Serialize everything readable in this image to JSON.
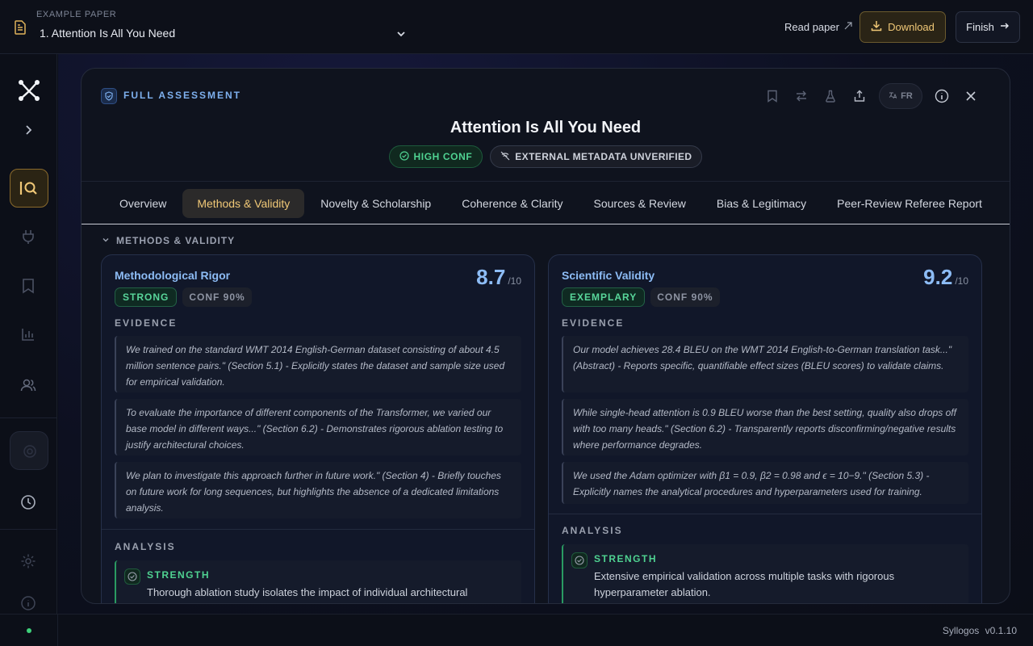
{
  "header": {
    "kicker": "EXAMPLE PAPER",
    "selected_paper": "1. Attention Is All You Need",
    "read_paper": "Read paper",
    "download": "Download",
    "finish": "Finish"
  },
  "footer": {
    "app_name": "Syllogos",
    "version": "v0.1.10"
  },
  "panel": {
    "kicker": "FULL ASSESSMENT",
    "title": "Attention Is All You Need",
    "badge_conf": "HIGH CONF",
    "badge_meta": "EXTERNAL METADATA UNVERIFIED",
    "lang": "FR",
    "tabs": [
      {
        "label": "Overview"
      },
      {
        "label": "Methods & Validity"
      },
      {
        "label": "Novelty & Scholarship"
      },
      {
        "label": "Coherence & Clarity"
      },
      {
        "label": "Sources & Review"
      },
      {
        "label": "Bias & Legitimacy"
      },
      {
        "label": "Peer-Review Referee Report"
      }
    ],
    "section": "METHODS & VALIDITY"
  },
  "cards": [
    {
      "title": "Methodological Rigor",
      "score": "8.7",
      "score_max": "/10",
      "rating": "STRONG",
      "confidence": "CONF 90%",
      "evidence_label": "EVIDENCE",
      "evidence": [
        "We trained on the standard WMT 2014 English-German dataset consisting of about 4.5 million sentence pairs.\" (Section 5.1) - Explicitly states the dataset and sample size used for empirical validation.",
        "To evaluate the importance of different components of the Transformer, we varied our base model in different ways...\" (Section 6.2) - Demonstrates rigorous ablation testing to justify architectural choices.",
        "We plan to investigate this approach further in future work.\" (Section 4) - Briefly touches on future work for long sequences, but highlights the absence of a dedicated limitations analysis."
      ],
      "analysis_label": "ANALYSIS",
      "strength_label": "STRENGTH",
      "strength_text": "Thorough ablation study isolates the impact of individual architectural"
    },
    {
      "title": "Scientific Validity",
      "score": "9.2",
      "score_max": "/10",
      "rating": "EXEMPLARY",
      "confidence": "CONF 90%",
      "evidence_label": "EVIDENCE",
      "evidence": [
        "Our model achieves 28.4 BLEU on the WMT 2014 English-to-German translation task...\" (Abstract) - Reports specific, quantifiable effect sizes (BLEU scores) to validate claims.",
        "While single-head attention is 0.9 BLEU worse than the best setting, quality also drops off with too many heads.\" (Section 6.2) - Transparently reports disconfirming/negative results where performance degrades.",
        "We used the Adam optimizer with β1 = 0.9, β2 = 0.98 and ϵ = 10−9.\" (Section 5.3) - Explicitly names the analytical procedures and hyperparameters used for training."
      ],
      "analysis_label": "ANALYSIS",
      "strength_label": "STRENGTH",
      "strength_text": "Extensive empirical validation across multiple tasks with rigorous hyperparameter ablation."
    }
  ]
}
